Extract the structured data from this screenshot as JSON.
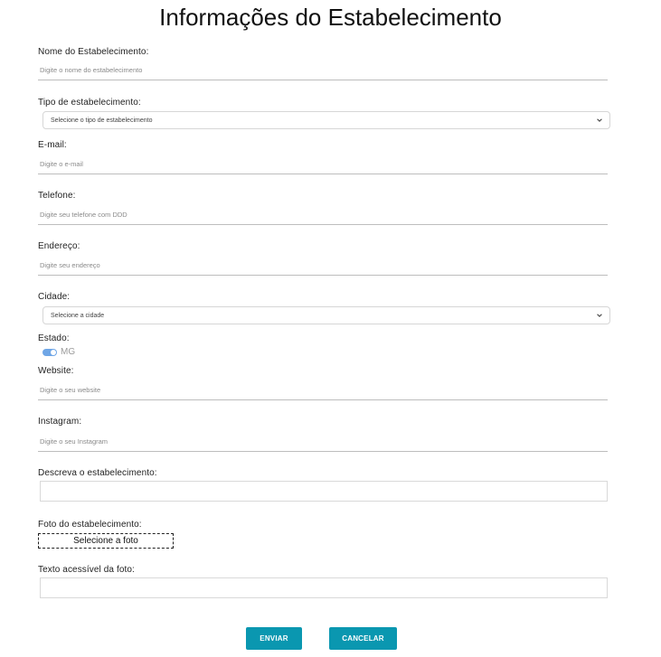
{
  "page": {
    "title": "Informações do Estabelecimento"
  },
  "form": {
    "nome": {
      "label": "Nome do Estabelecimento:",
      "placeholder": "Digite o nome do estabelecimento"
    },
    "tipo": {
      "label": "Tipo de estabelecimento:",
      "selected": "Selecione o tipo de estabelecimento"
    },
    "email": {
      "label": "E-mail:",
      "placeholder": "Digite o e-mail"
    },
    "telefone": {
      "label": "Telefone:",
      "placeholder": "Digite seu telefone com DDD"
    },
    "endereco": {
      "label": "Endereço:",
      "placeholder": "Digite seu endereço"
    },
    "cidade": {
      "label": "Cidade:",
      "selected": "Selecione a cidade"
    },
    "estado": {
      "label": "Estado:",
      "value": "MG"
    },
    "website": {
      "label": "Website:",
      "placeholder": "Digite o seu website"
    },
    "instagram": {
      "label": "Instagram:",
      "placeholder": "Digite o seu Instagram"
    },
    "descricao": {
      "label": "Descreva o estabelecimento:"
    },
    "foto": {
      "label": "Foto do estabelecimento:",
      "button_label": "Selecione a foto"
    },
    "texto_foto": {
      "label": "Texto acessível da foto:"
    }
  },
  "actions": {
    "submit_label": "ENVIAR",
    "cancel_label": "CANCELAR"
  },
  "colors": {
    "button": "#0a97b0",
    "toggle": "#6fa6e6"
  }
}
